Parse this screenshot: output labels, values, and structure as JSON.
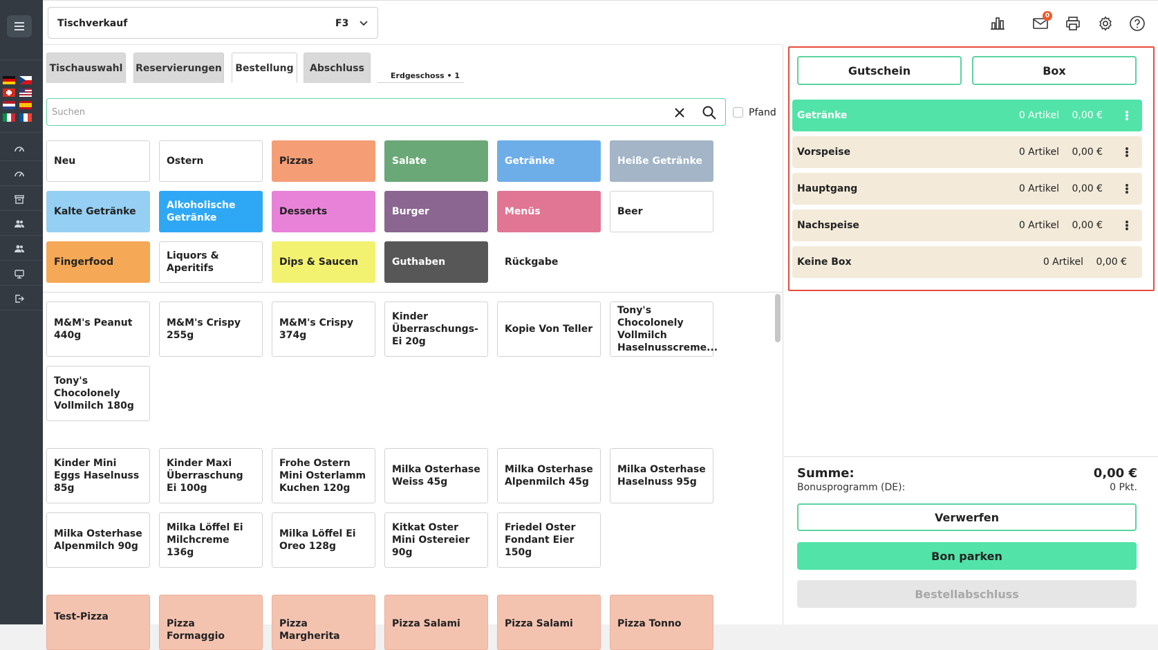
{
  "rail": {
    "menu_icon": "hamburger-menu-icon",
    "flags": [
      "de",
      "cz",
      "ch",
      "us",
      "nl",
      "es",
      "it",
      "fr"
    ],
    "icons": [
      "dashboard-icon",
      "dashboard-icon",
      "box-icon",
      "users-icon",
      "users-icon",
      "monitor-icon",
      "logout-icon"
    ]
  },
  "header": {
    "dropdown_title": "Tischverkauf",
    "dropdown_shortcut": "F3",
    "notification_count": "0",
    "icons": [
      "bar-chart-icon",
      "mail-icon",
      "printer-icon",
      "gear-icon",
      "help-icon"
    ]
  },
  "tabs": {
    "items": [
      "Tischauswahl",
      "Reservierungen",
      "Bestellung",
      "Abschluss"
    ],
    "active": "Bestellung",
    "floor_label": "Erdgeschoss • 1"
  },
  "search": {
    "placeholder": "Suchen",
    "pfand_label": "Pfand"
  },
  "categories": [
    {
      "label": "Neu",
      "color": "#ffffff"
    },
    {
      "label": "Ostern",
      "color": "#ffffff"
    },
    {
      "label": "Pizzas",
      "color": "#f59e76"
    },
    {
      "label": "Salate",
      "color": "#6aa878"
    },
    {
      "label": "Getränke",
      "color": "#6eaee8"
    },
    {
      "label": "Heiße Getränke",
      "color": "#a3b5c6"
    },
    {
      "label": "Kalte Getränke",
      "color": "#95cff3"
    },
    {
      "label": "Alkoholische Getränke",
      "color": "#2ea8f5"
    },
    {
      "label": "Desserts",
      "color": "#e882d8"
    },
    {
      "label": "Burger",
      "color": "#8a6690"
    },
    {
      "label": "Menüs",
      "color": "#e07594"
    },
    {
      "label": "Beer",
      "color": "#ffffff"
    },
    {
      "label": "Fingerfood",
      "color": "#f5a855"
    },
    {
      "label": "Liquors & Aperitifs",
      "color": "#ffffff"
    },
    {
      "label": "Dips & Saucen",
      "color": "#f3f270"
    },
    {
      "label": "Guthaben",
      "color": "#575757"
    },
    {
      "label": "Rückgabe",
      "color": "none"
    }
  ],
  "products_group1": [
    "M&M's Peanut 440g",
    "M&M's Crispy 255g",
    "M&M's Crispy 374g",
    "Kinder Überraschungs-Ei 20g",
    "Kopie Von Teller",
    "Tony's Chocolonely Vollmilch Haselnusscreme...",
    "Tony's Chocolonely Vollmilch 180g"
  ],
  "products_group2": [
    "Kinder Mini Eggs Haselnuss 85g",
    "Kinder Maxi Überraschung Ei 100g",
    "Frohe Ostern Mini Osterlamm Kuchen 120g",
    "Milka Osterhase Weiss 45g",
    "Milka Osterhase Alpenmilch 45g",
    "Milka Osterhase Haselnuss 95g",
    "Milka Osterhase Alpenmilch 90g",
    "Milka Löffel Ei Milchcreme 136g",
    "Milka Löffel Ei Oreo 128g",
    "Kitkat Oster Mini Ostereier 90g",
    "Friedel Oster Fondant Eier 150g"
  ],
  "products_group3": [
    "Test-Pizza",
    "Pizza Formaggio",
    "Pizza Margherita",
    "Pizza Salami",
    "Pizza Salami",
    "Pizza Tonno"
  ],
  "order_panel": {
    "voucher_label": "Gutschein",
    "box_label": "Box",
    "boxes": [
      {
        "name": "Getränke",
        "count": "0 Artikel",
        "price": "0,00 €",
        "active": true
      },
      {
        "name": "Vorspeise",
        "count": "0 Artikel",
        "price": "0,00 €",
        "active": false
      },
      {
        "name": "Hauptgang",
        "count": "0 Artikel",
        "price": "0,00 €",
        "active": false
      },
      {
        "name": "Nachspeise",
        "count": "0 Artikel",
        "price": "0,00 €",
        "active": false
      },
      {
        "name": "Keine Box",
        "count": "0 Artikel",
        "price": "0,00 €",
        "active": false
      }
    ],
    "sum_label": "Summe:",
    "sum_value": "0,00 €",
    "bonus_label": "Bonusprogramm (DE):",
    "bonus_value": "0 Pkt.",
    "discard_label": "Verwerfen",
    "park_label": "Bon parken",
    "finish_label": "Bestellabschluss"
  },
  "colors": {
    "accent": "#52e3a8",
    "accent_border": "#5bd3a1",
    "highlight_frame": "#e74c3c",
    "box_background": "#f3ead9",
    "rail": "#333a42"
  }
}
